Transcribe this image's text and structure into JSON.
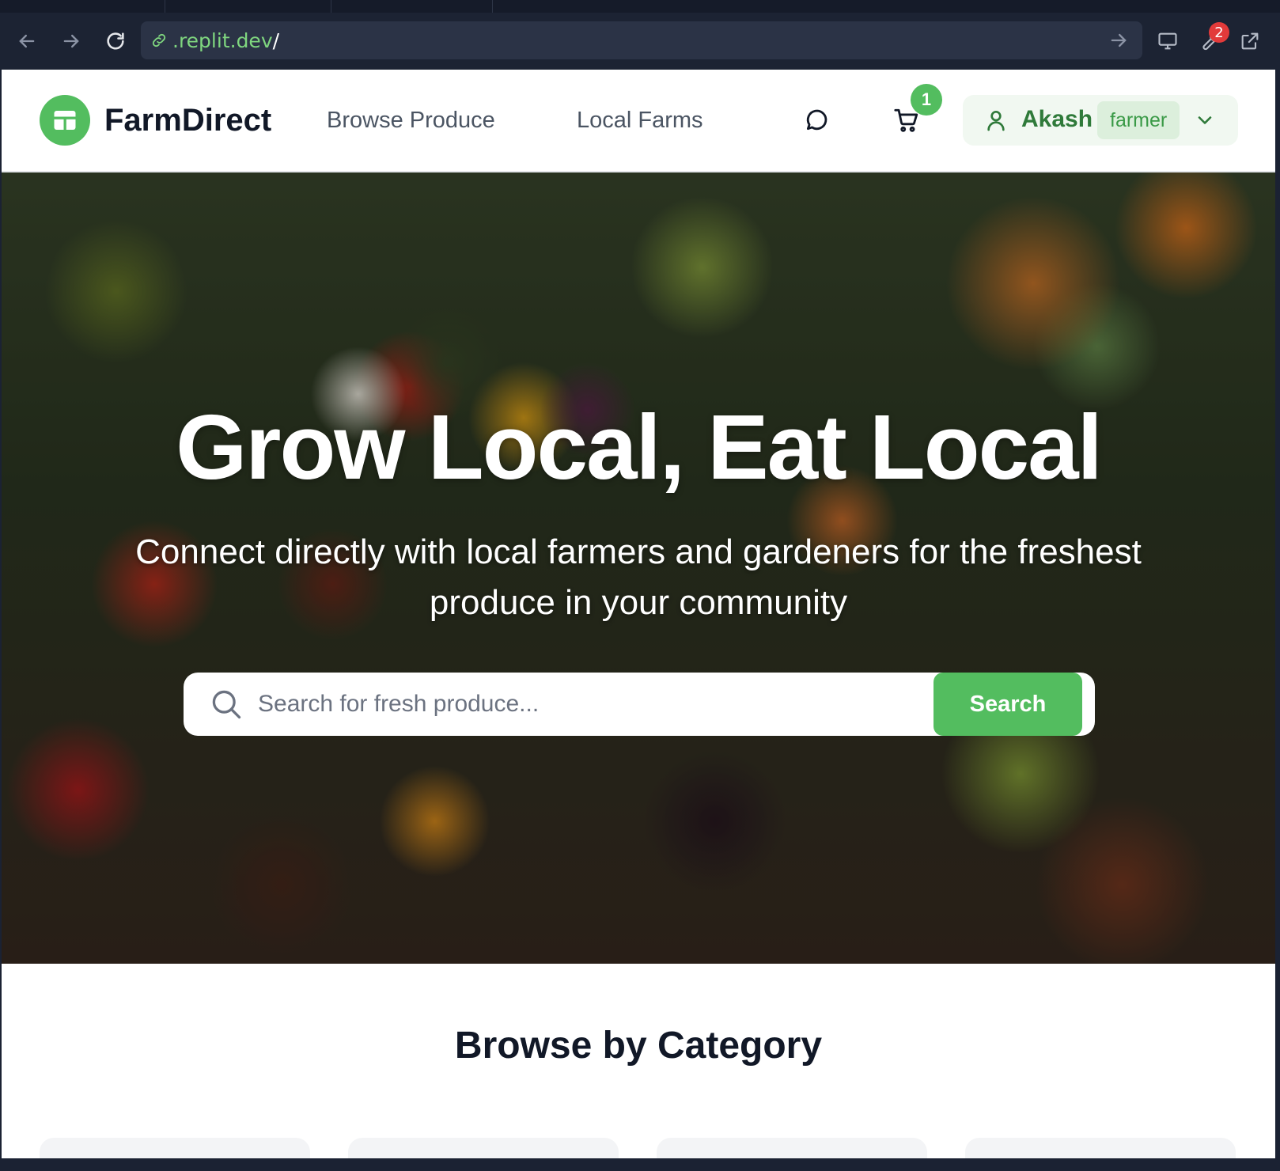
{
  "browser": {
    "url_host": ".replit.dev",
    "url_path": "/",
    "notification_count": "2"
  },
  "header": {
    "brand": "FarmDirect",
    "nav": [
      {
        "label": "Browse Produce"
      },
      {
        "label": "Local Farms"
      }
    ],
    "cart_count": "1",
    "user": {
      "name": "Akash",
      "role": "farmer"
    }
  },
  "hero": {
    "title": "Grow Local, Eat Local",
    "subtitle": "Connect directly with local farmers and gardeners for the freshest produce in your community",
    "search_placeholder": "Search for fresh produce...",
    "search_button": "Search"
  },
  "categories": {
    "title": "Browse by Category"
  },
  "colors": {
    "brand_green": "#53bd5f",
    "text_dark": "#111827",
    "chrome_bg": "#1c2333"
  }
}
